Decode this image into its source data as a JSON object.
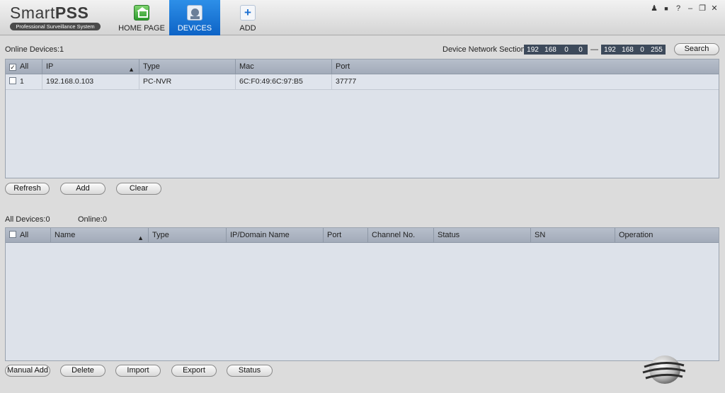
{
  "app": {
    "logo_main": "Smart",
    "logo_bold": "PSS",
    "logo_sub": "Professional Surveillance System"
  },
  "nav": {
    "home_label": "HOME PAGE",
    "devices_label": "DEVICES",
    "add_label": "ADD",
    "add_symbol": "+"
  },
  "window_controls": {
    "user": "♟",
    "lock": "🔒",
    "help": "?",
    "minimize": "–",
    "restore": "❐",
    "close": "✕"
  },
  "online": {
    "count_label": "Online Devices:1",
    "network_label": "Device Network Section:",
    "ip_start": [
      "192",
      "168",
      "0",
      "0"
    ],
    "ip_dash": "—",
    "ip_end": [
      "192",
      "168",
      "0",
      "255"
    ],
    "search_label": "Search",
    "columns": [
      "All",
      "IP",
      "Type",
      "Mac",
      "Port"
    ],
    "rows": [
      {
        "index": "1",
        "ip": "192.168.0.103",
        "type": "PC-NVR",
        "mac": "6C:F0:49:6C:97:B5",
        "port": "37777"
      }
    ],
    "buttons": {
      "refresh": "Refresh",
      "add": "Add",
      "clear": "Clear"
    }
  },
  "all_devices": {
    "count_label": "All Devices:0",
    "online_label": "Online:0",
    "columns": [
      "All",
      "Name",
      "Type",
      "IP/Domain Name",
      "Port",
      "Channel No.",
      "Status",
      "SN",
      "Operation"
    ],
    "buttons": {
      "manual_add": "Manual Add",
      "delete": "Delete",
      "import": "Import",
      "export": "Export",
      "status": "Status"
    }
  },
  "colors": {
    "accent": "#1a75d8",
    "table_header": "#a9b1be",
    "table_body": "#dde2ea"
  }
}
